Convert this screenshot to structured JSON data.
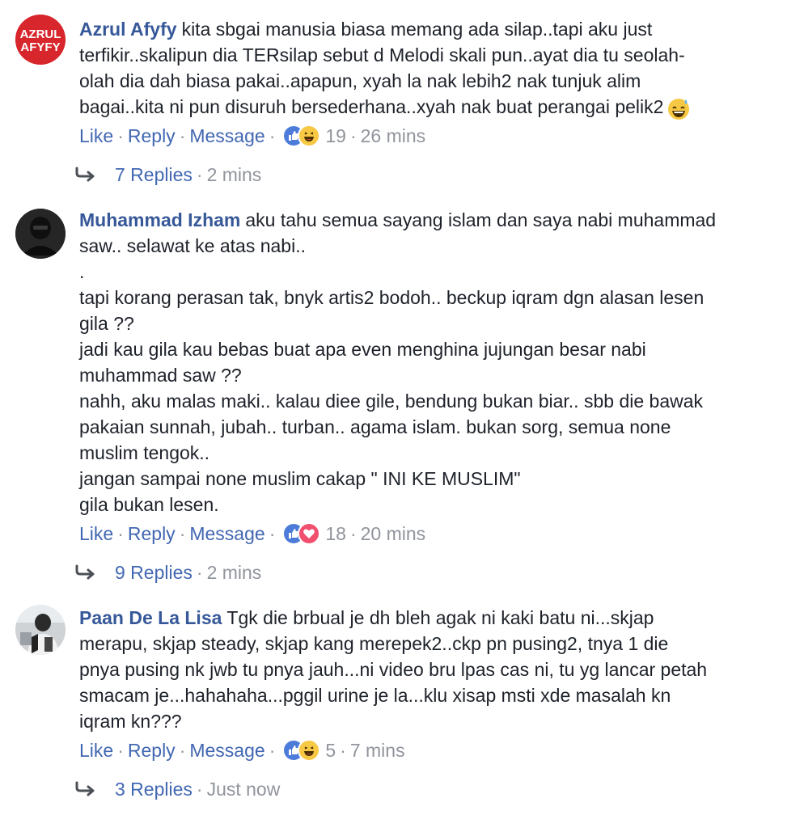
{
  "comments": [
    {
      "author": "Azrul Afyfy",
      "avatar_text": "AZRUL AFYFY",
      "lines": [
        "kita sbgai manusia biasa memang ada silap..tapi aku just",
        "terfikir..skalipun dia TERsilap sebut d Melodi skali pun..ayat dia tu seolah-",
        "olah dia dah biasa pakai..apapun, xyah la nak lebih2 nak tunjuk alim",
        "bagai..kita ni pun disuruh bersederhana..xyah nak buat perangai pelik2"
      ],
      "trailing_emoji": "grinning-sweat-emoji",
      "actions": {
        "like": "Like",
        "reply": "Reply",
        "message": "Message"
      },
      "reactions": [
        "like",
        "haha"
      ],
      "reaction_count": "19",
      "time": "26 mins",
      "replies_label": "7 Replies",
      "replies_time": "2 mins"
    },
    {
      "author": "Muhammad Izham",
      "lines": [
        "aku tahu semua sayang islam dan saya nabi muhammad",
        "saw.. selawat ke atas nabi..",
        ".",
        "tapi korang perasan tak, bnyk artis2 bodoh.. beckup iqram dgn alasan lesen",
        "gila ??",
        "jadi kau gila kau bebas buat apa even menghina jujungan besar nabi",
        "muhammad saw ??",
        "nahh, aku malas maki.. kalau diee gile, bendung bukan biar.. sbb die bawak",
        "pakaian sunnah, jubah.. turban.. agama islam. bukan sorg, semua none",
        "muslim tengok..",
        "jangan sampai none muslim cakap \" INI KE MUSLIM\"",
        "gila bukan lesen."
      ],
      "actions": {
        "like": "Like",
        "reply": "Reply",
        "message": "Message"
      },
      "reactions": [
        "like",
        "love"
      ],
      "reaction_count": "18",
      "time": "20 mins",
      "replies_label": "9 Replies",
      "replies_time": "2 mins"
    },
    {
      "author": "Paan De La Lisa",
      "lines": [
        "Tgk die brbual je dh bleh agak ni kaki batu ni...skjap",
        "merapu, skjap steady, skjap kang merepek2..ckp pn pusing2, tnya 1 die",
        "pnya pusing nk jwb tu pnya jauh...ni video bru lpas cas ni, tu yg lancar petah",
        "smacam je...hahahaha...pggil urine je la...klu xisap msti xde masalah kn",
        "iqram kn???"
      ],
      "actions": {
        "like": "Like",
        "reply": "Reply",
        "message": "Message"
      },
      "reactions": [
        "like",
        "haha"
      ],
      "reaction_count": "5",
      "time": "7 mins",
      "replies_label": "3 Replies",
      "replies_time": "Just now"
    }
  ],
  "colors": {
    "link": "#4267b2",
    "author": "#365899",
    "meta": "#90949c",
    "text": "#1d2129"
  }
}
